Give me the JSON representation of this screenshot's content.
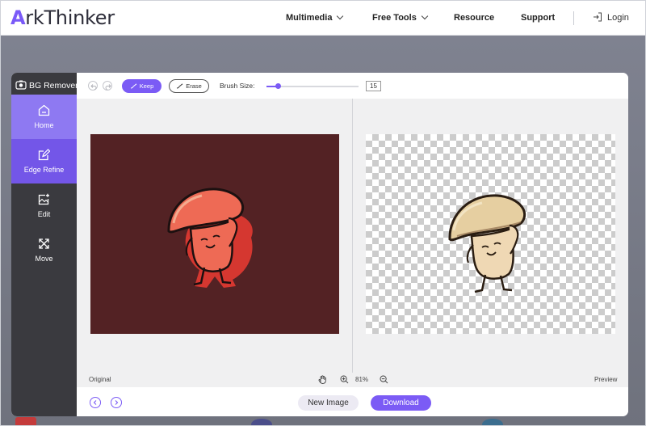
{
  "nav": {
    "logo_first": "A",
    "logo_rest": "rkThinker",
    "menu": [
      {
        "label": "Multimedia",
        "dropdown": true
      },
      {
        "label": "Free Tools",
        "dropdown": true
      },
      {
        "label": "Resource",
        "dropdown": false
      },
      {
        "label": "Support",
        "dropdown": false
      }
    ],
    "login": "Login"
  },
  "app": {
    "title": "BG Remover",
    "sidebar": [
      {
        "label": "Home",
        "icon": "home-icon"
      },
      {
        "label": "Edge Refine",
        "icon": "edit-square-icon"
      },
      {
        "label": "Edit",
        "icon": "image-add-icon"
      },
      {
        "label": "Move",
        "icon": "move-arrows-icon"
      }
    ],
    "toolbar": {
      "keep": "Keep",
      "erase": "Erase",
      "brush_size_label": "Brush Size:",
      "brush_size_value": "15",
      "brush_size_fraction": 0.12
    },
    "status": {
      "original": "Original",
      "zoom": "81%",
      "preview": "Preview"
    },
    "footer": {
      "new_image": "New Image",
      "download": "Download"
    },
    "colors": {
      "accent": "#7b5bf5",
      "sidebar_bg": "#3a3a3f",
      "original_bg": "#532224"
    }
  }
}
